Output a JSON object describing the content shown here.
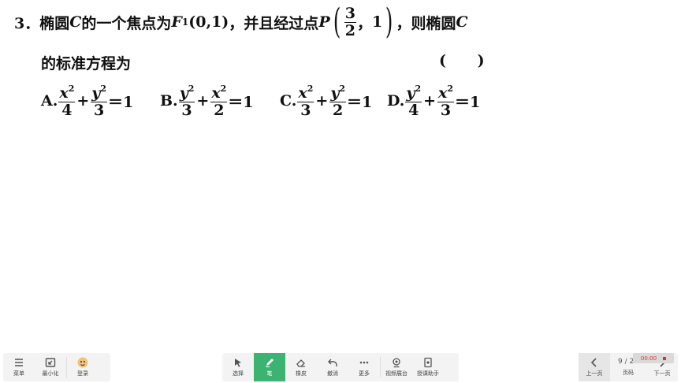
{
  "question": {
    "number": "3．",
    "text1": "椭圆 ",
    "var_c": "C",
    "text2": " 的一个焦点为 ",
    "focus_var": "F",
    "focus_sub": "1",
    "focus_coords": "(0,1)",
    "text3": "，并且经过点 ",
    "point_var": "P",
    "point_x_num": "3",
    "point_x_den": "2",
    "point_sep": "，",
    "point_y": "1",
    "text4": "，则椭圆 ",
    "text5": "的标准方程为",
    "answer_paren": "(      )"
  },
  "options": [
    {
      "label": "A.",
      "t1_num_var": "x",
      "t1_den": "4",
      "t2_num_var": "y",
      "t2_den": "3",
      "exp": "2",
      "plus": "+",
      "eq": "＝1"
    },
    {
      "label": "B.",
      "t1_num_var": "y",
      "t1_den": "3",
      "t2_num_var": "x",
      "t2_den": "2",
      "exp": "2",
      "plus": "+",
      "eq": "＝1"
    },
    {
      "label": "C.",
      "t1_num_var": "x",
      "t1_den": "3",
      "t2_num_var": "y",
      "t2_den": "2",
      "exp": "2",
      "plus": "+",
      "eq": "＝1"
    },
    {
      "label": "D.",
      "t1_num_var": "y",
      "t1_den": "4",
      "t2_num_var": "x",
      "t2_den": "3",
      "exp": "2",
      "plus": "+",
      "eq": "＝1"
    }
  ],
  "toolbar": {
    "left": [
      {
        "label": "菜单",
        "icon": "menu-icon"
      },
      {
        "label": "最小化",
        "icon": "minimize-icon"
      },
      {
        "label": "登录",
        "icon": "avatar-icon"
      }
    ],
    "center": [
      {
        "label": "选择",
        "icon": "cursor-icon"
      },
      {
        "label": "笔",
        "icon": "pen-icon",
        "active": true
      },
      {
        "label": "橡皮",
        "icon": "eraser-icon"
      },
      {
        "label": "撤消",
        "icon": "undo-icon"
      },
      {
        "label": "更多",
        "icon": "more-icon"
      },
      {
        "label": "视频展台",
        "icon": "camera-icon"
      },
      {
        "label": "授课助手",
        "icon": "assistant-icon"
      }
    ],
    "right": {
      "prev_label": "上一页",
      "page_indicator": "9 / 28",
      "page_label": "页码",
      "next_label": "下一页"
    },
    "record_time": "00:00",
    "accent": "#3cb371"
  }
}
